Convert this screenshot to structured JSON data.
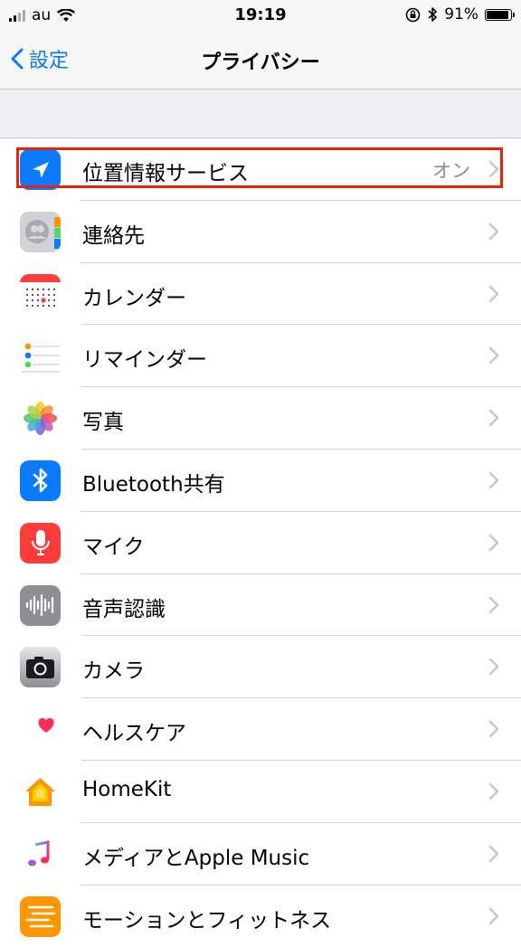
{
  "status": {
    "carrier": "au",
    "time": "19:19",
    "battery": "91%",
    "battery_level": 0.91
  },
  "nav": {
    "back_label": "設定",
    "title": "プライバシー"
  },
  "rows": [
    {
      "label": "位置情報サービス",
      "value": "オン",
      "icon": "location-icon",
      "color": "#0a7aff"
    },
    {
      "label": "連絡先",
      "value": "",
      "icon": "contacts-icon",
      "color": "#c9c9ce"
    },
    {
      "label": "カレンダー",
      "value": "",
      "icon": "calendar-icon",
      "color": "#ffffff"
    },
    {
      "label": "リマインダー",
      "value": "",
      "icon": "reminders-icon",
      "color": "#ffffff"
    },
    {
      "label": "写真",
      "value": "",
      "icon": "photos-icon",
      "color": "#ffffff"
    },
    {
      "label": "Bluetooth共有",
      "value": "",
      "icon": "bluetooth-icon",
      "color": "#0a7aff"
    },
    {
      "label": "マイク",
      "value": "",
      "icon": "microphone-icon",
      "color": "#fc3d39"
    },
    {
      "label": "音声認識",
      "value": "",
      "icon": "speech-recognition-icon",
      "color": "#8e8e93"
    },
    {
      "label": "カメラ",
      "value": "",
      "icon": "camera-icon",
      "color": "#8e8e93"
    },
    {
      "label": "ヘルスケア",
      "value": "",
      "icon": "health-icon",
      "color": "#ffffff"
    },
    {
      "label": "HomeKit",
      "value": "",
      "icon": "homekit-icon",
      "color": "#ffffff"
    },
    {
      "label": "メディアとApple Music",
      "value": "",
      "icon": "music-icon",
      "color": "#ffffff"
    },
    {
      "label": "モーションとフィットネス",
      "value": "",
      "icon": "motion-icon",
      "color": "#ff9500"
    }
  ]
}
